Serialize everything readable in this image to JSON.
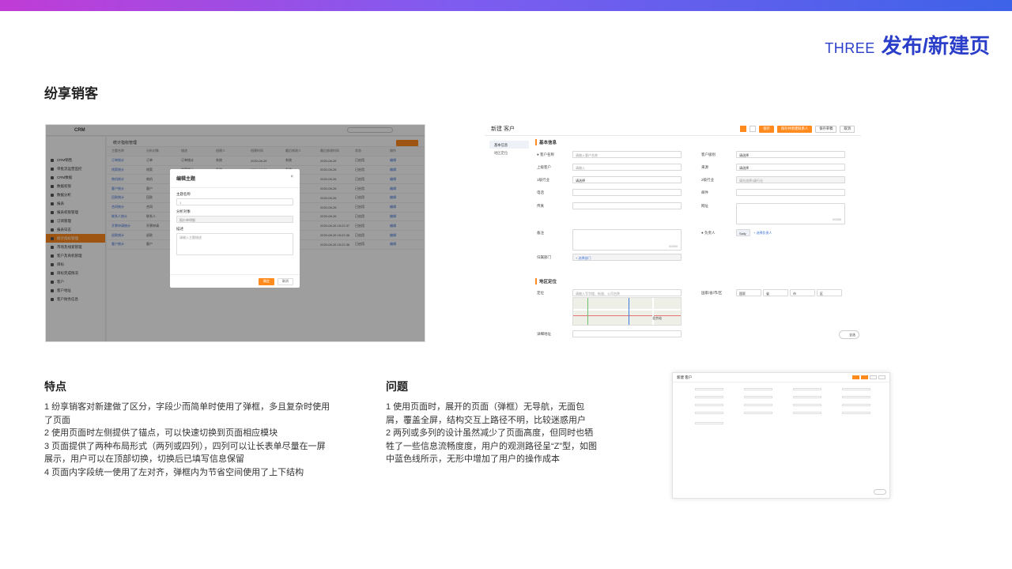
{
  "header": {
    "section_number": "THREE",
    "section_title": "发布/新建页"
  },
  "case_title": "纷享销客",
  "shot1": {
    "brand": "CRM",
    "nav": [
      "CRM销售",
      "单批流运营监控",
      "CRM数据",
      "数据权限",
      "数据分析",
      "报表",
      "报表权限管理",
      "订阅管理",
      "报表日志",
      "统计指标管理",
      "市场及线索管理",
      "客户及商机管理",
      "目标",
      "目标完成情况",
      "客户",
      "客户地址",
      "客户财务信息"
    ],
    "page_title": "统计指标管理",
    "table_header": [
      "主题名称",
      "分析对象",
      "描述",
      "创建人",
      "创建时间",
      "最后修改人",
      "最后修改时间",
      "状态",
      "操作"
    ],
    "rows": [
      [
        "订单统计",
        "订单",
        "订单统计",
        "系统",
        "2020-08-26",
        "系统",
        "2020-08-26",
        "已启用",
        "编辑"
      ],
      [
        "线索统计",
        "线索",
        "线索统计",
        "系统",
        "2020-08-26",
        "系统",
        "2020-08-26",
        "已启用",
        "编辑"
      ],
      [
        "商机统计",
        "商机",
        "商机统计",
        "系统",
        "2020-08-26",
        "系统",
        "2020-08-26",
        "已启用",
        "编辑"
      ],
      [
        "客户统计",
        "客户",
        "客户统计",
        "系统",
        "2020-08-26",
        "系统",
        "2020-08-26",
        "已启用",
        "编辑"
      ],
      [
        "回款统计",
        "回款",
        "回款统计",
        "系统",
        "2020-08-26",
        "系统",
        "2020-08-26",
        "已启用",
        "编辑"
      ],
      [
        "合同统计",
        "合同",
        "合同统计",
        "系统",
        "2020-08-26",
        "系统",
        "2020-08-26",
        "已启用",
        "编辑"
      ],
      [
        "联系人统计",
        "联系人",
        "联系人统计",
        "系统",
        "2020-08-26",
        "系统",
        "2020-08-26",
        "已启用",
        "编辑"
      ],
      [
        "开票申请统计",
        "开票申请",
        "开票申请统计",
        "系统",
        "2020-08-26 15:22:37",
        "系统",
        "2020-08-26 15:22:37",
        "已启用",
        "编辑"
      ],
      [
        "退款统计",
        "退款",
        "退款统计",
        "系统",
        "2020-08-26 15:22:36",
        "系统",
        "2020-08-26 15:22:36",
        "已启用",
        "编辑"
      ],
      [
        "客户统计",
        "客户",
        "客户统计",
        "系统",
        "2020-08-26 15:22:36",
        "系统",
        "2020-08-26 15:22:36",
        "已启用",
        "编辑"
      ]
    ],
    "modal": {
      "title": "编辑主题",
      "name_label": "主题名称",
      "name_value": "1",
      "object_label": "分析对象",
      "object_value": "报价单明细",
      "desc_label": "描述",
      "desc_placeholder": "请输入主题描述",
      "ok_label": "确定",
      "cancel_label": "取消"
    }
  },
  "shot2": {
    "title": "新建 客户",
    "buttons": [
      "保存",
      "保存并新建联系人",
      "保存草稿",
      "取消"
    ],
    "anchors": [
      "基本信息",
      "地区定位"
    ],
    "section_basic": "基本信息",
    "section_geo": "地区定位",
    "fields_left": [
      {
        "label": "客户名称",
        "value": "请输入客户名称"
      },
      {
        "label": "上级客户",
        "value": "请输入"
      },
      {
        "label": "1级行业",
        "value": "请选择"
      },
      {
        "label": "电话",
        "value": ""
      },
      {
        "label": "传真",
        "value": ""
      },
      {
        "label": "备注",
        "value": ""
      },
      {
        "label": "归属部门",
        "value": "+ 选择部门"
      }
    ],
    "fields_right": [
      {
        "label": "客户级别",
        "value": "请选择"
      },
      {
        "label": "来源",
        "value": "请选择"
      },
      {
        "label": "2级行业",
        "value": "请先选择1级行业"
      },
      {
        "label": "邮件",
        "value": ""
      },
      {
        "label": "网址",
        "value": ""
      },
      {
        "label": "负责人",
        "value": "Sally"
      }
    ],
    "counter_a": "0/2000",
    "counter_b": "0/2000",
    "owner_add": "+ 选择负责人",
    "locate_label": "定位",
    "locate_placeholder": "请输入写字楼、街道、公司名称",
    "region_label": "国家/省/市/区",
    "region_values": [
      "国家",
      "省",
      "市",
      "区"
    ],
    "address_label": "详细地址",
    "map_pin": "北京站",
    "toggle_label": "全选"
  },
  "features": {
    "title": "特点",
    "lines": [
      "1 纷享销客对新建做了区分，字段少而简单时使用了弹框，多且复杂时使用了页面",
      "2 使用页面时左侧提供了锚点，可以快速切换到页面相应模块",
      "3 页面提供了两种布局形式（两列或四列），四列可以让长表单尽量在一屏展示，用户可以在顶部切换，切换后已填写信息保留",
      "4 页面内字段统一使用了左对齐，弹框内为节省空间使用了上下结构"
    ]
  },
  "problems": {
    "title": "问题",
    "lines": [
      "1 使用页面时，展开的页面（弹框）无导航，无面包屑，覆盖全屏，结构交互上路径不明，比较迷惑用户",
      "2 两列或多列的设计虽然减少了页面高度，但同时也牺牲了一些信息流畅度度，用户的观测路径呈“Z”型，如图中蓝色线所示，无形中增加了用户的操作成本"
    ]
  },
  "colors": {
    "accent_blue": "#2a3ec9",
    "brand_orange": "#ff8a1d"
  }
}
